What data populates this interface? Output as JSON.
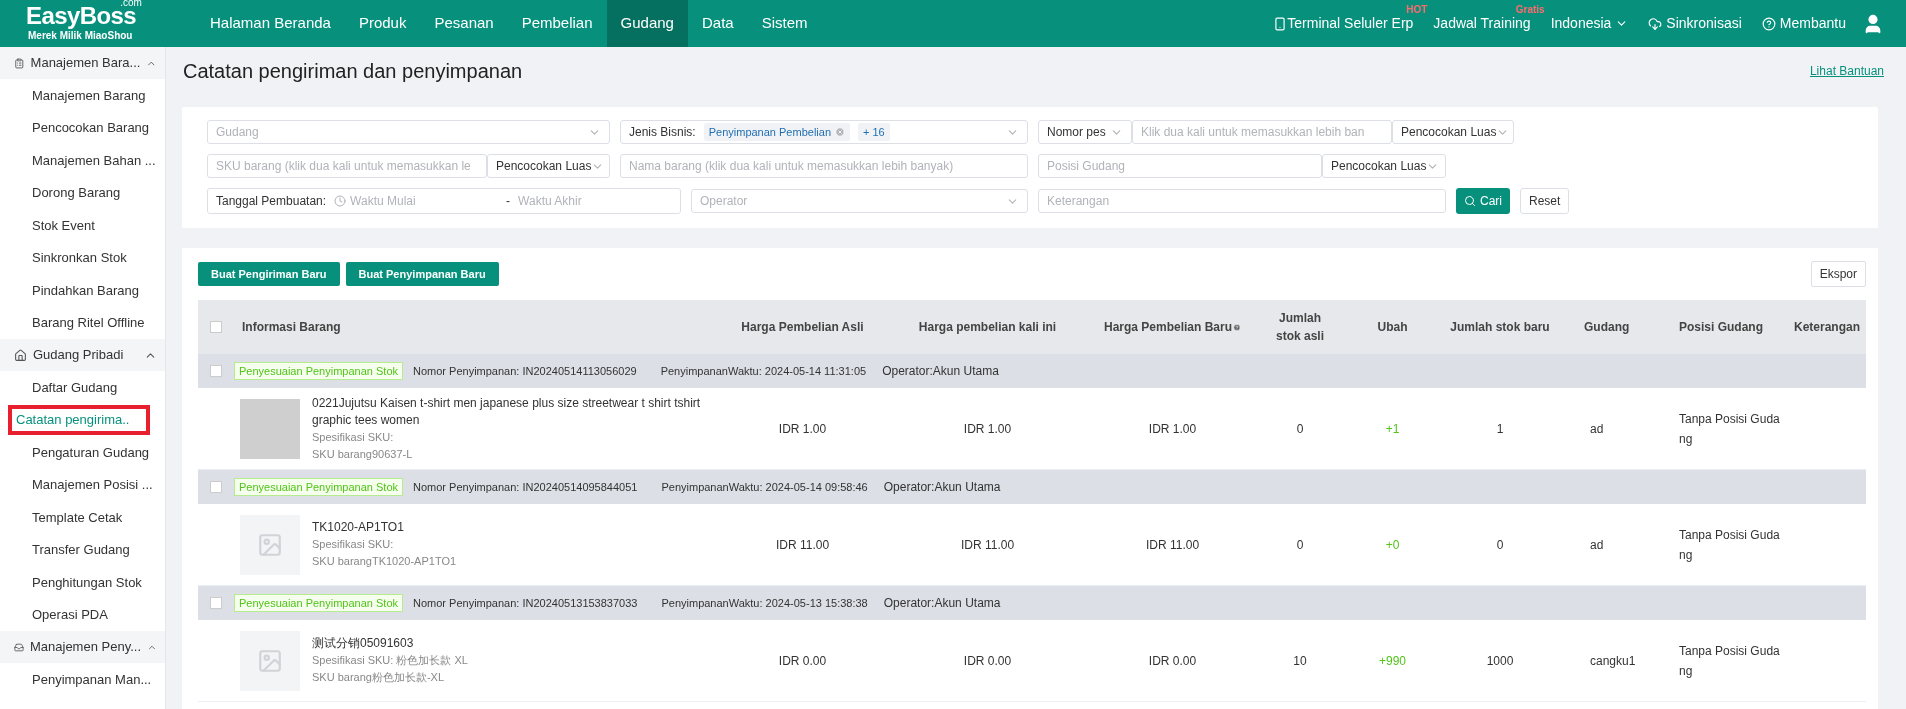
{
  "top_bar": {
    "logo": {
      "name": "EasyBoss",
      "suffix": ".com",
      "tagline": "Merek Milik MiaoShou"
    },
    "menu": [
      {
        "label": "Halaman Beranda",
        "selected": false
      },
      {
        "label": "Produk",
        "selected": false
      },
      {
        "label": "Pesanan",
        "selected": false
      },
      {
        "label": "Pembelian",
        "selected": false
      },
      {
        "label": "Gudang",
        "selected": true
      },
      {
        "label": "Data",
        "selected": false
      },
      {
        "label": "Sistem",
        "selected": false
      }
    ],
    "actions": [
      {
        "kind": "phone",
        "label": "Terminal Seluler Erp",
        "badge": "HOT"
      },
      {
        "kind": "plain",
        "label": "Jadwal Training",
        "badge": "Gratis"
      },
      {
        "kind": "dropdown",
        "label": "Indonesia"
      },
      {
        "kind": "cloud",
        "label": "Sinkronisasi"
      },
      {
        "kind": "help",
        "label": "Membantu"
      },
      {
        "kind": "user"
      }
    ]
  },
  "sidebar": [
    {
      "label": "Manajemen Bara...",
      "kind": "clipboard",
      "expanded": true,
      "items": [
        {
          "label": "Manajemen Barang",
          "selected": false,
          "highlighted": false
        },
        {
          "label": "Pencocokan Barang",
          "selected": false,
          "highlighted": false
        },
        {
          "label": "Manajemen Bahan ...",
          "selected": false,
          "highlighted": false
        },
        {
          "label": "Dorong Barang",
          "selected": false,
          "highlighted": false
        },
        {
          "label": "Stok Event",
          "selected": false,
          "highlighted": false
        },
        {
          "label": "Sinkronkan Stok",
          "selected": false,
          "highlighted": false
        },
        {
          "label": "Pindahkan Barang",
          "selected": false,
          "highlighted": false
        },
        {
          "label": "Barang Ritel Offline",
          "selected": false,
          "highlighted": false
        }
      ]
    },
    {
      "label": "Gudang Pribadi",
      "kind": "house",
      "expanded": true,
      "items": [
        {
          "label": "Daftar Gudang",
          "selected": false,
          "highlighted": false
        },
        {
          "label": "Catatan pengirima..",
          "selected": true,
          "highlighted": true
        },
        {
          "label": "Pengaturan Gudang",
          "selected": false,
          "highlighted": false
        },
        {
          "label": "Manajemen Posisi ...",
          "selected": false,
          "highlighted": false
        },
        {
          "label": "Template Cetak",
          "selected": false,
          "highlighted": false
        },
        {
          "label": "Transfer Gudang",
          "selected": false,
          "highlighted": false
        },
        {
          "label": "Penghitungan Stok",
          "selected": false,
          "highlighted": false
        },
        {
          "label": "Operasi PDA",
          "selected": false,
          "highlighted": false
        }
      ]
    },
    {
      "label": "Manajemen Peny...",
      "kind": "inbox",
      "expanded": true,
      "items": [
        {
          "label": "Penyimpanan Man...",
          "selected": false,
          "highlighted": false
        }
      ]
    }
  ],
  "page": {
    "title": "Catatan pengiriman dan penyimpanan",
    "help_link": "Lihat Bantuan"
  },
  "filters": {
    "warehouse": {
      "placeholder": "Gudang"
    },
    "business_type": {
      "label": "Jenis Bisnis:",
      "tag": "Penyimpanan Pembelian",
      "more": "+ 16"
    },
    "order_no": {
      "type": "Nomor pes",
      "placeholder": "Klik dua kali untuk memasukkan lebih ban",
      "match": "Pencocokan Luas"
    },
    "sku": {
      "placeholder": "SKU barang (klik dua kali untuk memasukkan le",
      "match": "Pencocokan Luas"
    },
    "item_name": {
      "placeholder": "Nama barang (klik dua kali untuk memasukkan lebih banyak)"
    },
    "position": {
      "placeholder": "Posisi Gudang",
      "match": "Pencocokan Luas"
    },
    "date": {
      "label": "Tanggal Pembuatan:",
      "start": "Waktu Mulai",
      "separator": "-",
      "end": "Waktu Akhir"
    },
    "operator": {
      "placeholder": "Operator"
    },
    "note": {
      "placeholder": "Keterangan"
    },
    "search_button": "Cari",
    "reset_button": "Reset"
  },
  "toolbar": {
    "buttons": [
      "Buat Pengiriman Baru",
      "Buat Penyimpanan Baru"
    ],
    "export": "Ekspor"
  },
  "table": {
    "header_checked": false,
    "columns": [
      "Informasi Barang",
      "Harga Pembelian Asli",
      "Harga pembelian kali ini",
      "Harga Pembelian Baru",
      "Jumlah stok asli",
      "Ubah",
      "Jumlah stok baru",
      "Gudang",
      "Posisi Gudang",
      "Keterangan"
    ],
    "records": [
      {
        "checked": false,
        "tag": "Penyesuaian Penyimpanan Stok",
        "number": "Nomor Penyimpanan: IN20240514113056029",
        "time": "PenyimpananWaktu: 2024-05-14 11:31:05",
        "operator": "Operator:Akun Utama",
        "item": {
          "kind": "photo",
          "title": "0221Jujutsu Kaisen t-shirt men japanese plus size streetwear t shirt tshirt graphic tees women",
          "spec": "Spesifikasi SKU:",
          "sku": "SKU barang90637-L",
          "price_orig": "IDR 1.00",
          "price_now": "IDR 1.00",
          "price_new": "IDR 1.00",
          "stock_orig": "0",
          "change": "+1",
          "stock_new": "1",
          "warehouse": "ad",
          "position": "Tanpa Posisi Gudang"
        }
      },
      {
        "checked": false,
        "tag": "Penyesuaian Penyimpanan Stok",
        "number": "Nomor Penyimpanan: IN20240514095844051",
        "time": "PenyimpananWaktu: 2024-05-14 09:58:46",
        "operator": "Operator:Akun Utama",
        "item": {
          "kind": "placeholder",
          "title": "TK1020-AP1TO1",
          "spec": "Spesifikasi SKU:",
          "sku": "SKU barangTK1020-AP1TO1",
          "price_orig": "IDR 11.00",
          "price_now": "IDR 11.00",
          "price_new": "IDR 11.00",
          "stock_orig": "0",
          "change": "+0",
          "stock_new": "0",
          "warehouse": "ad",
          "position": "Tanpa Posisi Gudang"
        }
      },
      {
        "checked": false,
        "tag": "Penyesuaian Penyimpanan Stok",
        "number": "Nomor Penyimpanan: IN20240513153837033",
        "time": "PenyimpananWaktu: 2024-05-13 15:38:38",
        "operator": "Operator:Akun Utama",
        "item": {
          "kind": "placeholder",
          "title": "测试分销05091603",
          "spec": "Spesifikasi SKU: 粉色加长款 XL",
          "sku": "SKU barang粉色加长款-XL",
          "price_orig": "IDR 0.00",
          "price_now": "IDR 0.00",
          "price_new": "IDR 0.00",
          "stock_orig": "10",
          "change": "+990",
          "stock_new": "1000",
          "warehouse": "cangku1",
          "position": "Tanpa Posisi Gudang"
        }
      }
    ]
  }
}
